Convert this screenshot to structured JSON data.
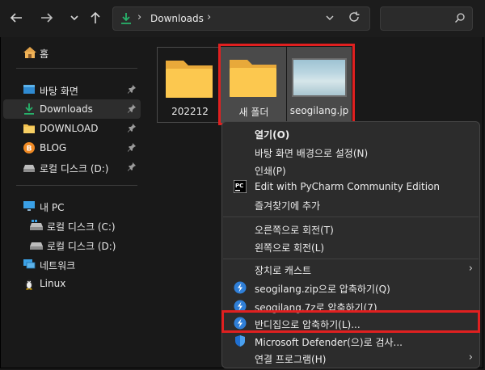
{
  "toolbar": {
    "back_icon": "back-arrow-icon",
    "forward_icon": "forward-arrow-icon",
    "recent_icon": "chevron-down-icon",
    "up_icon": "up-arrow-icon"
  },
  "address": {
    "crumb": "Downloads",
    "separator": "›"
  },
  "sidebar": {
    "home": "홈",
    "quick_access": [
      {
        "label": "바탕 화면",
        "icon": "desktop-icon"
      },
      {
        "label": "Downloads",
        "icon": "download-icon"
      },
      {
        "label": "DOWNLOAD",
        "icon": "folder-icon"
      },
      {
        "label": "BLOG",
        "icon": "blog-icon"
      },
      {
        "label": "로컬 디스크 (D:)",
        "icon": "drive-icon"
      }
    ],
    "this_pc": "내 PC",
    "drives": [
      "로컬 디스크 (C:)",
      "로컬 디스크 (D:)"
    ],
    "network": "네트워크",
    "linux": "Linux"
  },
  "files": [
    {
      "name": "202212",
      "type": "folder"
    },
    {
      "name": "새 폴더",
      "type": "folder"
    },
    {
      "name": "seogilang.jp",
      "type": "image"
    }
  ],
  "context_menu": {
    "items": [
      {
        "label": "열기(O)",
        "bold": true,
        "icon": ""
      },
      {
        "label": "바탕 화면 배경으로 설정(N)",
        "icon": ""
      },
      {
        "label": "인쇄(P)",
        "icon": ""
      },
      {
        "label": "Edit with PyCharm Community Edition",
        "icon": "pycharm-icon"
      },
      {
        "label": "즐겨찾기에 추가",
        "icon": ""
      },
      {
        "label": "오른쪽으로 회전(T)",
        "icon": ""
      },
      {
        "label": "왼쪽으로 회전(L)",
        "icon": ""
      },
      {
        "label": "장치로 캐스트",
        "icon": "",
        "submenu": true
      },
      {
        "label": "seogilang.zip으로 압축하기(Q)",
        "icon": "bandizip-icon"
      },
      {
        "label": "seogilang.7z로 압축하기(7)",
        "icon": "bandizip-icon"
      },
      {
        "label": "반디집으로 압축하기(L)...",
        "icon": "bandizip-icon"
      },
      {
        "label": "Microsoft Defender(으)로 검사...",
        "icon": "defender-shield-icon"
      },
      {
        "label": "연결 프로그램(H)",
        "icon": "",
        "submenu": true
      }
    ],
    "submenu_arrow": "›"
  },
  "colors": {
    "highlight_border": "#e02020",
    "background": "#191919",
    "menu_background": "#2c2c2c",
    "selected_tile": "#4a4a4a"
  }
}
